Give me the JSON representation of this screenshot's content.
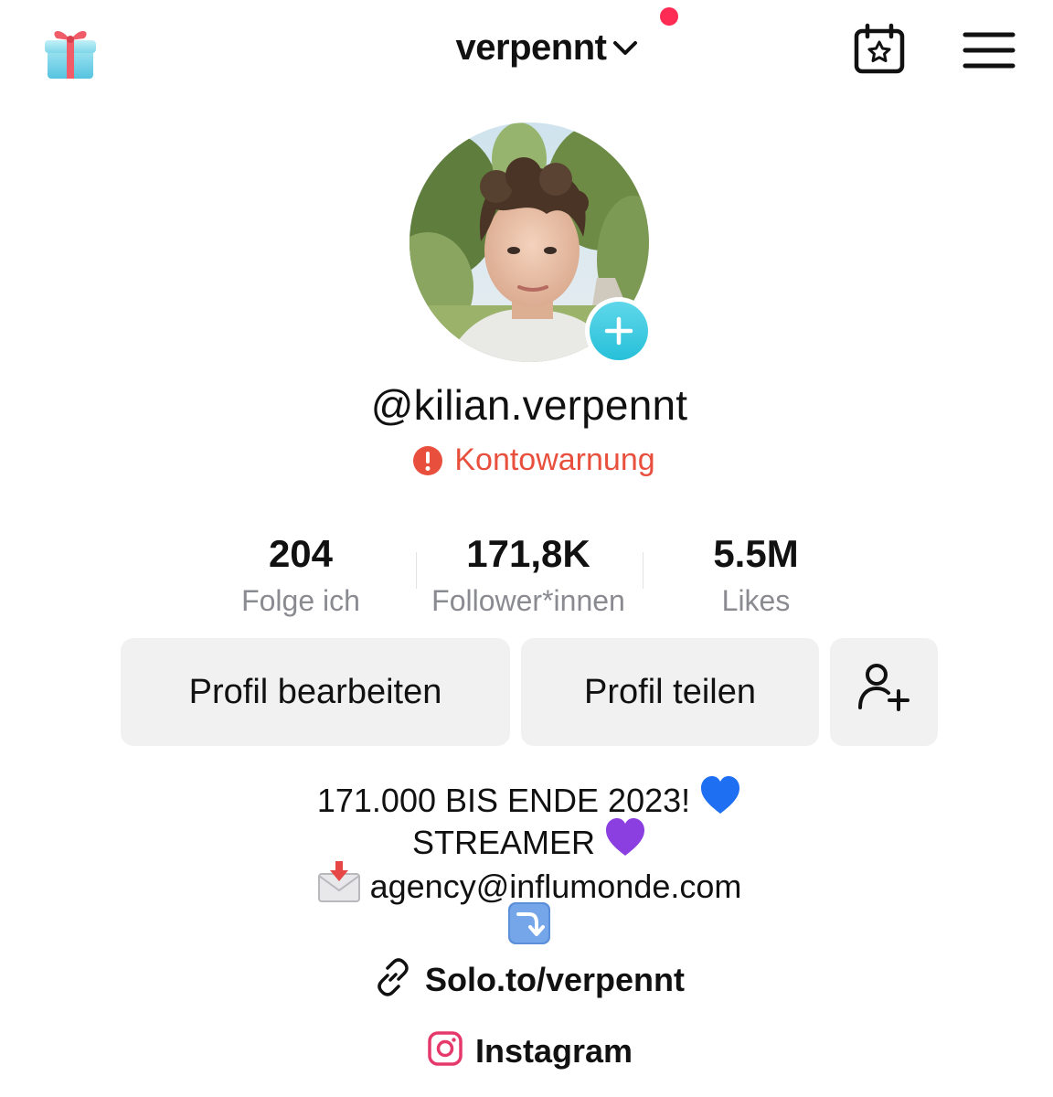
{
  "header": {
    "account_name": "verpennt",
    "icons": [
      "gift-icon",
      "chevron-down-icon",
      "calendar-star-icon",
      "menu-icon"
    ],
    "notification_color": "#fe2c55"
  },
  "profile": {
    "username": "@kilian.verpennt",
    "warning_label": "Kontowarnung",
    "warning_color": "#e8503d"
  },
  "stats": [
    {
      "value": "204",
      "label": "Folge ich"
    },
    {
      "value": "171,8K",
      "label": "Follower*innen"
    },
    {
      "value": "5.5M",
      "label": "Likes"
    }
  ],
  "actions": {
    "edit_label": "Profil bearbeiten",
    "share_label": "Profil teilen",
    "add_friend_icon": "person-plus-icon"
  },
  "bio": {
    "line1": "171.000 BIS ENDE 2023! ",
    "line1_emoji": "💙",
    "line2": "STREAMER ",
    "line2_emoji": "💜",
    "line3_emoji": "📩",
    "line3": " agency@influmonde.com",
    "line4_emoji": "⤵️"
  },
  "links": {
    "website": "Solo.to/verpennt",
    "instagram": "Instagram"
  }
}
